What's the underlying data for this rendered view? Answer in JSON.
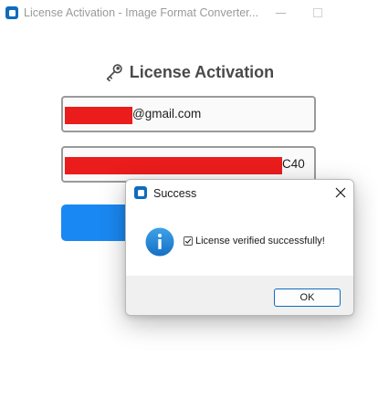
{
  "window": {
    "title": "License Activation - Image Format Converter...",
    "icon": "app-icon"
  },
  "main": {
    "heading": "License Activation",
    "heading_icon": "key-icon",
    "email_value": "@gmail.com",
    "license_key_value": "C40",
    "activate_button_color": "#1a88f2"
  },
  "dialog": {
    "title": "Success",
    "icon": "info-icon",
    "message": "License verified successfully!",
    "message_icon": "check-icon",
    "ok_label": "OK"
  },
  "colors": {
    "accent": "#0f6cbd",
    "redaction": "#ea1c1c",
    "info": "#1e86d4"
  }
}
